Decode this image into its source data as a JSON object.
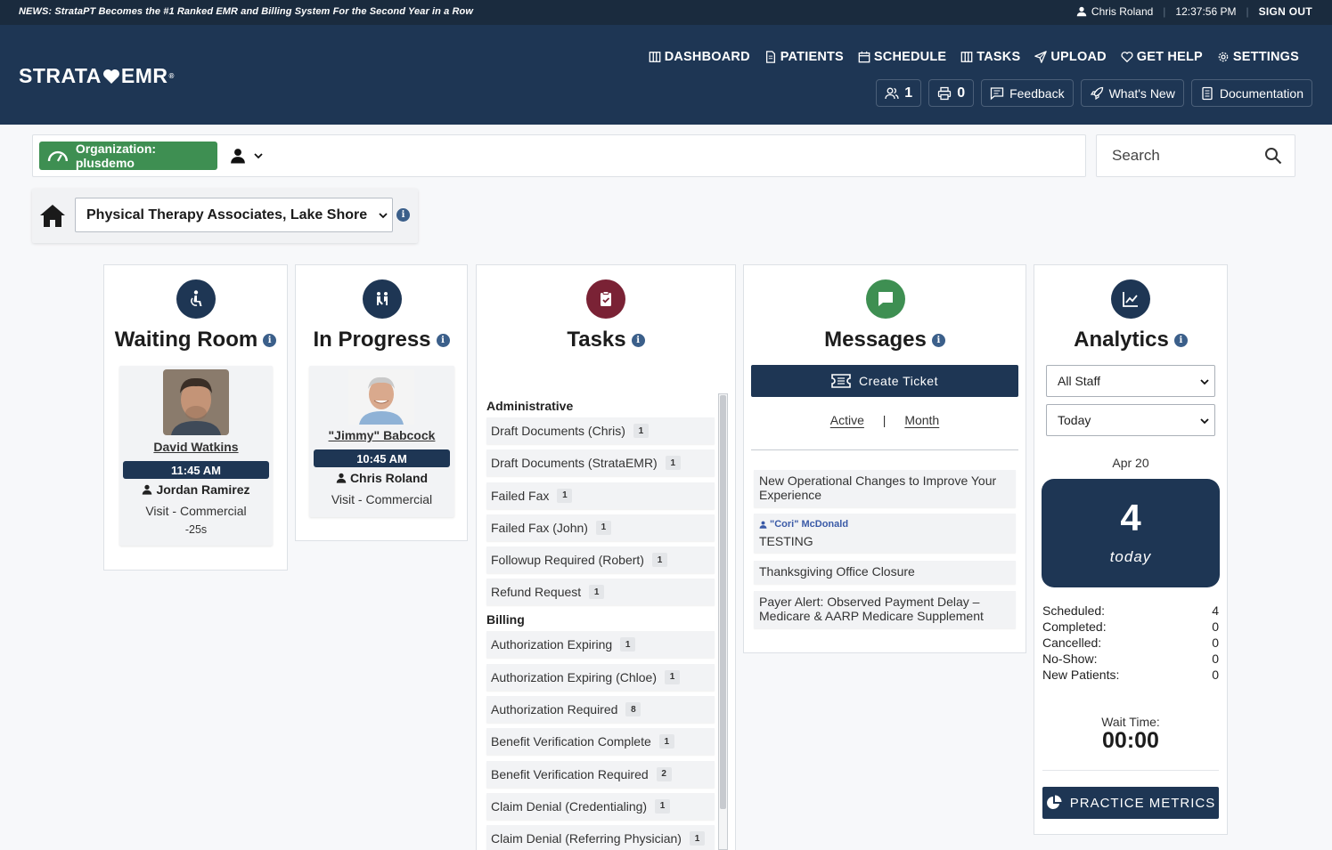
{
  "news": "NEWS: StrataPT Becomes the #1 Ranked EMR and Billing System For the Second Year in a Row",
  "topbar": {
    "user": "Chris Roland",
    "time": "12:37:56 PM",
    "signout": "SIGN OUT"
  },
  "logo": {
    "left": "STRATA",
    "right": "EMR",
    "tm": "®"
  },
  "nav": {
    "dashboard": "DASHBOARD",
    "patients": "PATIENTS",
    "schedule": "SCHEDULE",
    "tasks": "TASKS",
    "upload": "UPLOAD",
    "get_help": "GET HELP",
    "settings": "SETTINGS"
  },
  "subnav": {
    "users_count": "1",
    "print_count": "0",
    "feedback": "Feedback",
    "whats_new": "What's New",
    "documentation": "Documentation"
  },
  "org": {
    "label": "Organization: plusdemo"
  },
  "search": {
    "placeholder": "Search"
  },
  "location": {
    "selected": "Physical Therapy Associates, Lake Shore"
  },
  "waiting_room": {
    "title": "Waiting Room",
    "patient": {
      "name": "David Watkins",
      "time": "11:45 AM",
      "provider": "Jordan Ramirez",
      "visit": "Visit - Commercial",
      "wait": "-25s"
    }
  },
  "in_progress": {
    "title": "In Progress",
    "patient": {
      "name": "\"Jimmy\" Babcock",
      "time": "10:45 AM",
      "provider": "Chris Roland",
      "visit": "Visit - Commercial"
    }
  },
  "tasks": {
    "title": "Tasks",
    "groups": [
      {
        "name": "Administrative",
        "items": [
          {
            "label": "Draft Documents (Chris)",
            "count": "1"
          },
          {
            "label": "Draft Documents (StrataEMR)",
            "count": "1"
          },
          {
            "label": "Failed Fax",
            "count": "1"
          },
          {
            "label": "Failed Fax (John)",
            "count": "1"
          },
          {
            "label": "Followup Required (Robert)",
            "count": "1"
          },
          {
            "label": "Refund Request",
            "count": "1"
          }
        ]
      },
      {
        "name": "Billing",
        "items": [
          {
            "label": "Authorization Expiring",
            "count": "1"
          },
          {
            "label": "Authorization Expiring (Chloe)",
            "count": "1"
          },
          {
            "label": "Authorization Required",
            "count": "8"
          },
          {
            "label": "Benefit Verification Complete",
            "count": "1"
          },
          {
            "label": "Benefit Verification Required",
            "count": "2"
          },
          {
            "label": "Claim Denial (Credentialing)",
            "count": "1"
          },
          {
            "label": "Claim Denial (Referring Physician)",
            "count": "1"
          }
        ]
      }
    ]
  },
  "messages": {
    "title": "Messages",
    "create_ticket": "Create Ticket",
    "tab_active": "Active",
    "tab_sep": "|",
    "tab_month": "Month",
    "items": [
      {
        "text": "New Operational Changes to Improve Your Experience"
      },
      {
        "author": "\"Cori\" McDonald",
        "text": "TESTING"
      },
      {
        "text": "Thanksgiving Office Closure"
      },
      {
        "text": "Payer Alert: Observed Payment Delay – Medicare & AARP Medicare Supplement"
      }
    ]
  },
  "analytics": {
    "title": "Analytics",
    "staff_select": "All Staff",
    "period_select": "Today",
    "date": "Apr 20",
    "count": "4",
    "count_label": "today",
    "stats": [
      {
        "label": "Scheduled:",
        "value": "4"
      },
      {
        "label": "Completed:",
        "value": "0"
      },
      {
        "label": "Cancelled:",
        "value": "0"
      },
      {
        "label": "No-Show:",
        "value": "0"
      },
      {
        "label": "New Patients:",
        "value": "0"
      }
    ],
    "wait_label": "Wait Time:",
    "wait_value": "00:00",
    "metrics_button": "PRACTICE METRICS"
  },
  "colors": {
    "navy": "#1e3654",
    "green": "#3e8f52",
    "tasks_red": "#7a2235",
    "messages_green": "#3e8f52"
  }
}
